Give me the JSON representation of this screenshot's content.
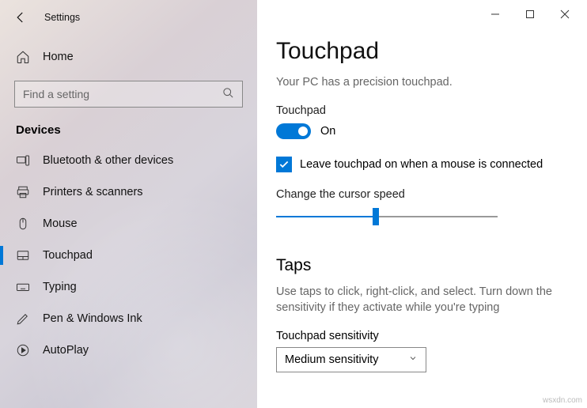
{
  "window": {
    "title": "Settings"
  },
  "sidebar": {
    "home_label": "Home",
    "search_placeholder": "Find a setting",
    "section_header": "Devices",
    "items": [
      {
        "label": "Bluetooth & other devices"
      },
      {
        "label": "Printers & scanners"
      },
      {
        "label": "Mouse"
      },
      {
        "label": "Touchpad"
      },
      {
        "label": "Typing"
      },
      {
        "label": "Pen & Windows Ink"
      },
      {
        "label": "AutoPlay"
      }
    ]
  },
  "main": {
    "title": "Touchpad",
    "subtitle": "Your PC has a precision touchpad.",
    "touchpad_label": "Touchpad",
    "toggle_state": "On",
    "checkbox_label": "Leave touchpad on when a mouse is connected",
    "cursor_speed_label": "Change the cursor speed",
    "taps_header": "Taps",
    "taps_desc": "Use taps to click, right-click, and select. Turn down the sensitivity if they activate while you're typing",
    "sensitivity_label": "Touchpad sensitivity",
    "sensitivity_value": "Medium sensitivity"
  },
  "watermark": "wsxdn.com"
}
